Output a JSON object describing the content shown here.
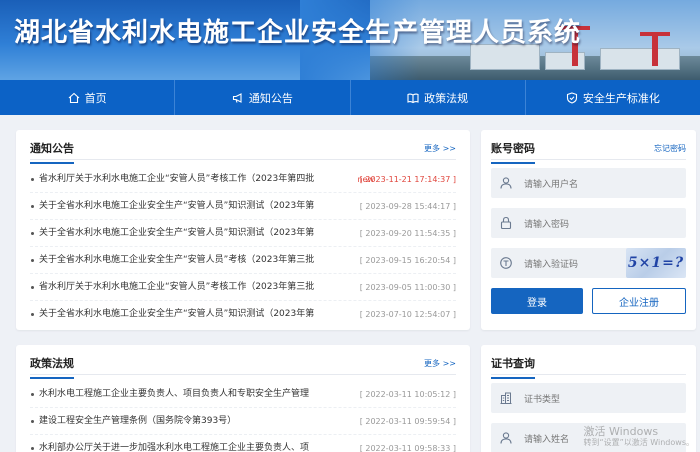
{
  "site": {
    "title": "湖北省水利水电施工企业安全生产管理人员系统"
  },
  "nav": [
    {
      "label": "首页",
      "icon": "home-icon"
    },
    {
      "label": "通知公告",
      "icon": "megaphone-icon"
    },
    {
      "label": "政策法规",
      "icon": "book-icon"
    },
    {
      "label": "安全生产标准化",
      "icon": "shield-check-icon"
    }
  ],
  "notices": {
    "title": "通知公告",
    "more": "更多 >>",
    "items": [
      {
        "title": "省水利厅关于水利水电施工企业“安管人员”考核工作（2023年第四批",
        "tag": "new",
        "date": "[ 2023-11-21 17:14:37 ]",
        "hot": true
      },
      {
        "title": "关于全省水利水电施工企业安全生产“安管人员”知识测试（2023年第",
        "tag": "",
        "date": "[ 2023-09-28 15:44:17 ]",
        "hot": false
      },
      {
        "title": "关于全省水利水电施工企业安全生产“安管人员”知识测试（2023年第",
        "tag": "",
        "date": "[ 2023-09-20 11:54:35 ]",
        "hot": false
      },
      {
        "title": "关于全省水利水电施工企业安全生产“安管人员”考核（2023年第三批",
        "tag": "",
        "date": "[ 2023-09-15 16:20:54 ]",
        "hot": false
      },
      {
        "title": "省水利厅关于水利水电施工企业“安管人员”考核工作（2023年第三批",
        "tag": "",
        "date": "[ 2023-09-05 11:00:30 ]",
        "hot": false
      },
      {
        "title": "关于全省水利水电施工企业安全生产“安管人员”知识测试（2023年第",
        "tag": "",
        "date": "[ 2023-07-10 12:54:07 ]",
        "hot": false
      }
    ]
  },
  "policies": {
    "title": "政策法规",
    "more": "更多 >>",
    "items": [
      {
        "title": "水利水电工程施工企业主要负责人、项目负责人和专职安全生产管理",
        "date": "[ 2022-03-11 10:05:12 ]"
      },
      {
        "title": "建设工程安全生产管理条例（国务院令第393号）",
        "date": "[ 2022-03-11 09:59:54 ]"
      },
      {
        "title": "水利部办公厅关于进一步加强水利水电工程施工企业主要负责人、项",
        "date": "[ 2022-03-11 09:58:33 ]"
      }
    ]
  },
  "login": {
    "title": "账号密码",
    "forgot": "忘记密码",
    "username_placeholder": "请输入用户名",
    "password_placeholder": "请输入密码",
    "captcha_placeholder": "请输入验证码",
    "captcha_text": "5×1=?",
    "login_button": "登录",
    "register_button": "企业注册"
  },
  "cert": {
    "title": "证书查询",
    "type_placeholder": "证书类型",
    "name_placeholder": "请输入姓名"
  },
  "watermark": {
    "line1": "激活 Windows",
    "line2": "转到“设置”以激活 Windows。"
  }
}
